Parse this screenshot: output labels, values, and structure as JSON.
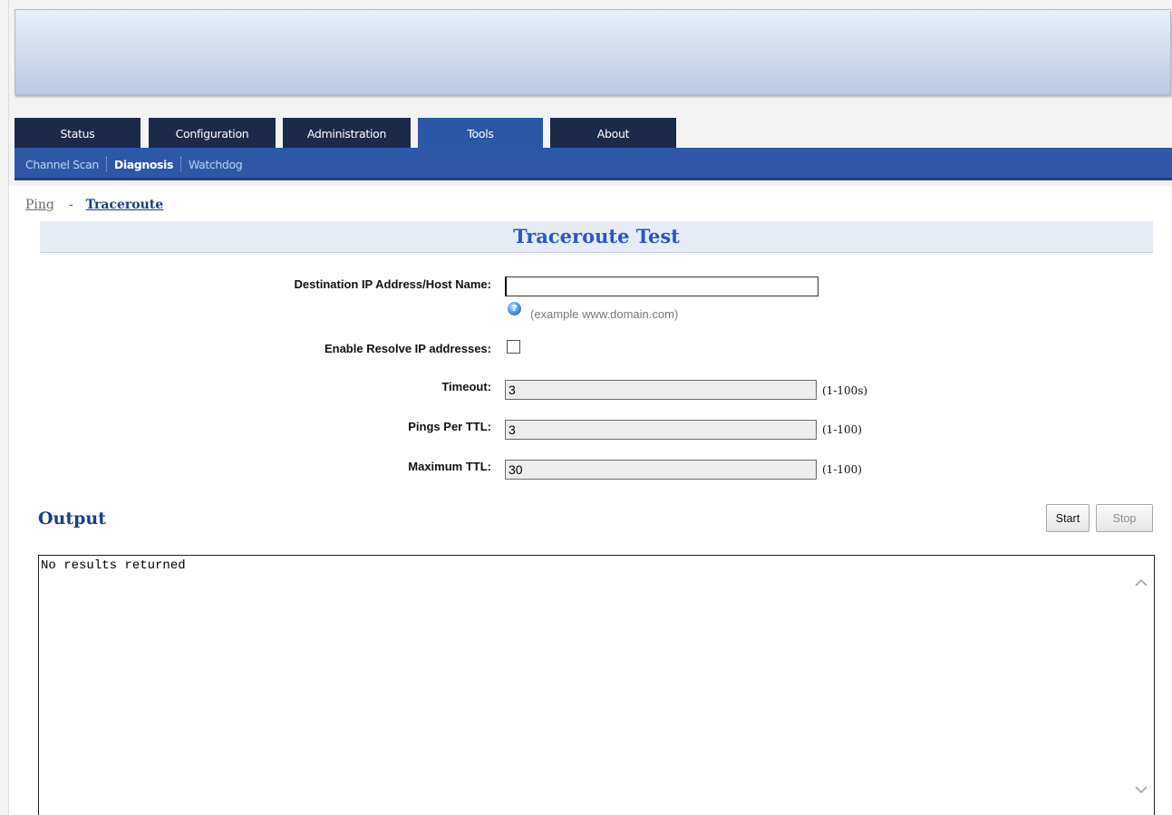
{
  "tabs": [
    {
      "label": "Status",
      "active": false
    },
    {
      "label": "Configuration",
      "active": false
    },
    {
      "label": "Administration",
      "active": false
    },
    {
      "label": "Tools",
      "active": true
    },
    {
      "label": "About",
      "active": false
    }
  ],
  "subnav": [
    {
      "label": "Channel Scan",
      "active": false
    },
    {
      "label": "Diagnosis",
      "active": true
    },
    {
      "label": "Watchdog",
      "active": false
    }
  ],
  "breadcrumb": {
    "ping": "Ping",
    "separator": "-",
    "traceroute": "Traceroute"
  },
  "section_title": "Traceroute Test",
  "form": {
    "destination": {
      "label": "Destination IP Address/Host Name:",
      "value": "",
      "hint": "(example www.domain.com)"
    },
    "resolve": {
      "label": "Enable Resolve IP addresses:",
      "checked": false
    },
    "timeout": {
      "label": "Timeout:",
      "value": "3",
      "range": "(1-100s)"
    },
    "pings_per_ttl": {
      "label": "Pings Per TTL:",
      "value": "3",
      "range": "(1-100)"
    },
    "max_ttl": {
      "label": "Maximum TTL:",
      "value": "30",
      "range": "(1-100)"
    }
  },
  "output": {
    "title": "Output",
    "start_label": "Start",
    "stop_label": "Stop",
    "text": "No results returned"
  },
  "icons": {
    "help": "help-icon",
    "scroll_up": "chevron-up-icon",
    "scroll_down": "chevron-down-icon"
  },
  "colors": {
    "tab_bg": "#1c2a4a",
    "tab_active": "#2a57a6",
    "subbar": "#2e58a7",
    "title": "#2a57c4",
    "heading": "#1a3f85"
  }
}
